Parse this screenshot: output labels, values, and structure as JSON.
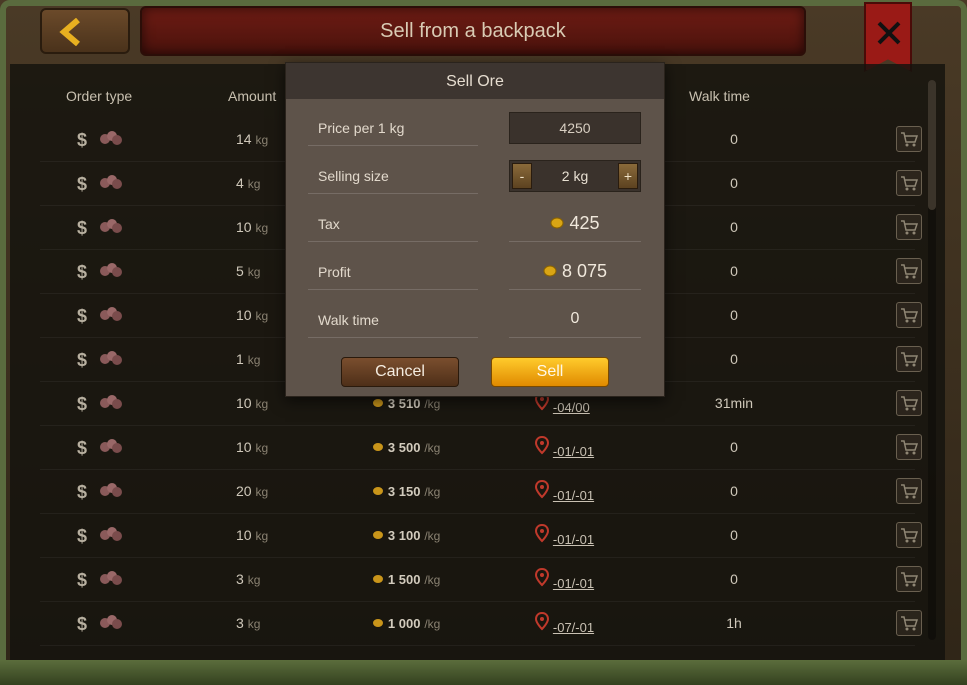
{
  "window": {
    "title": "Sell from a backpack"
  },
  "columns": {
    "order_type": "Order type",
    "amount": "Amount",
    "walk_time": "Walk time"
  },
  "rows": [
    {
      "amount": "14",
      "unit": "kg",
      "price": "",
      "price_unit": "",
      "coord": "",
      "walk": "0"
    },
    {
      "amount": "4",
      "unit": "kg",
      "price": "",
      "price_unit": "",
      "coord": "",
      "walk": "0"
    },
    {
      "amount": "10",
      "unit": "kg",
      "price": "",
      "price_unit": "",
      "coord": "",
      "walk": "0"
    },
    {
      "amount": "5",
      "unit": "kg",
      "price": "",
      "price_unit": "",
      "coord": "",
      "walk": "0"
    },
    {
      "amount": "10",
      "unit": "kg",
      "price": "",
      "price_unit": "",
      "coord": "",
      "walk": "0"
    },
    {
      "amount": "1",
      "unit": "kg",
      "price": "",
      "price_unit": "",
      "coord": "",
      "walk": "0"
    },
    {
      "amount": "10",
      "unit": "kg",
      "price": "3 510",
      "price_unit": "/kg",
      "coord": "-04/00",
      "walk": "31min"
    },
    {
      "amount": "10",
      "unit": "kg",
      "price": "3 500",
      "price_unit": "/kg",
      "coord": "-01/-01",
      "walk": "0"
    },
    {
      "amount": "20",
      "unit": "kg",
      "price": "3 150",
      "price_unit": "/kg",
      "coord": "-01/-01",
      "walk": "0"
    },
    {
      "amount": "10",
      "unit": "kg",
      "price": "3 100",
      "price_unit": "/kg",
      "coord": "-01/-01",
      "walk": "0"
    },
    {
      "amount": "3",
      "unit": "kg",
      "price": "1 500",
      "price_unit": "/kg",
      "coord": "-01/-01",
      "walk": "0"
    },
    {
      "amount": "3",
      "unit": "kg",
      "price": "1 000",
      "price_unit": "/kg",
      "coord": "-07/-01",
      "walk": "1h"
    }
  ],
  "dialog": {
    "title": "Sell Ore",
    "price_label": "Price per 1 kg",
    "price_value": "4250",
    "size_label": "Selling size",
    "size_value": "2 kg",
    "minus": "-",
    "plus": "+",
    "tax_label": "Tax",
    "tax_value": "425",
    "profit_label": "Profit",
    "profit_value": "8 075",
    "walk_label": "Walk time",
    "walk_value": "0",
    "cancel": "Cancel",
    "sell": "Sell"
  },
  "colors": {
    "accent": "#f0a000",
    "title_bar": "#6e1c14",
    "coord_pin": "#c0392b"
  },
  "icons": [
    "back-arrow-icon",
    "close-icon",
    "dollar-icon",
    "ore-icon",
    "gold-coin-icon",
    "location-pin-icon",
    "cart-icon"
  ]
}
